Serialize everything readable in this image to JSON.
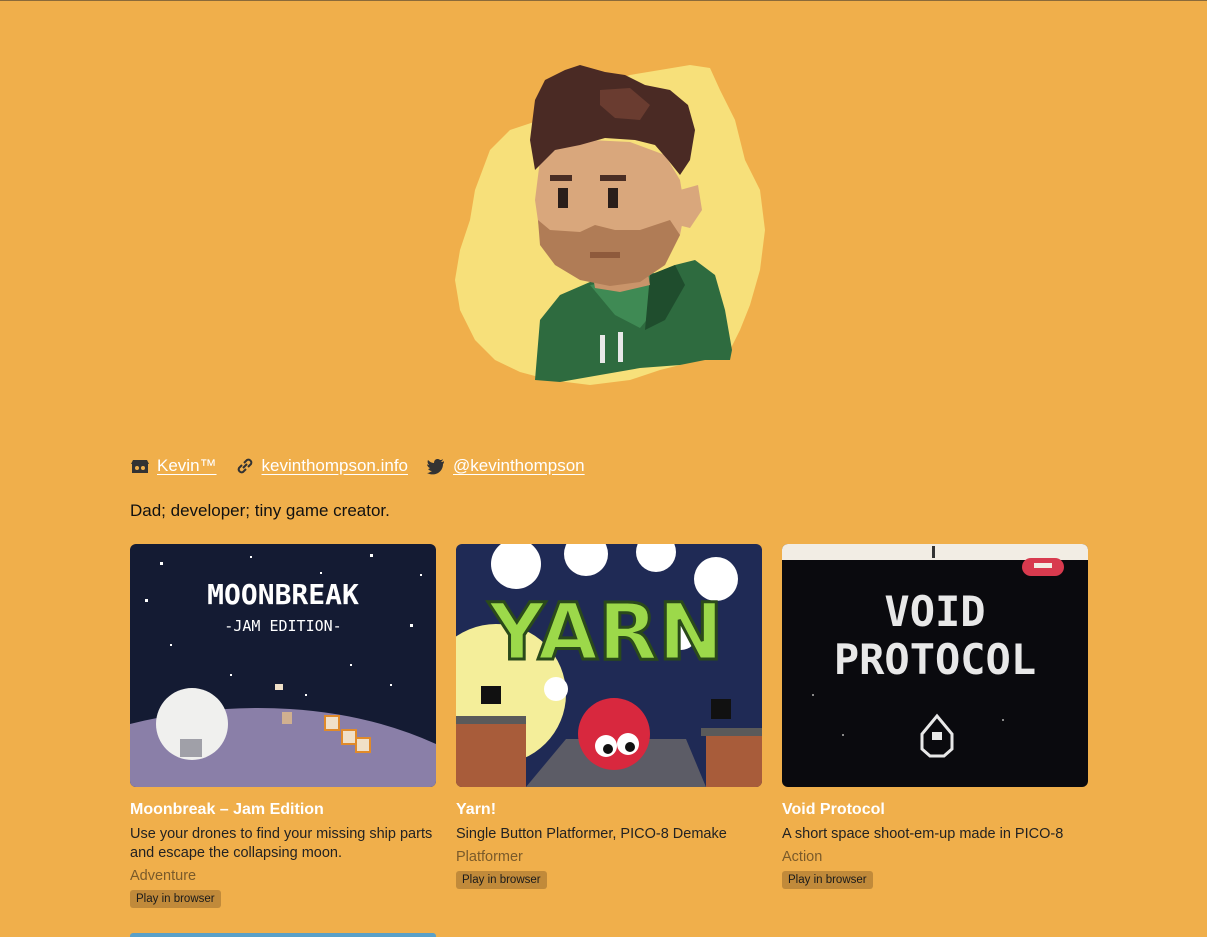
{
  "profile": {
    "name_link": "Kevin™",
    "website_link": "kevinthompson.info",
    "twitter_link": "@kevinthompson",
    "bio": "Dad; developer; tiny game creator."
  },
  "icons": {
    "itch": "itchio-icon",
    "website": "link-icon",
    "twitter": "twitter-icon"
  },
  "colors": {
    "background": "#F0AF4B",
    "badge": "#C18A3A",
    "title": "#FFFFFF"
  },
  "games": [
    {
      "title": "Moonbreak – Jam Edition",
      "thumb_title": "MOONBREAK",
      "thumb_subtitle": "-JAM EDITION-",
      "description": "Use your drones to find your missing ship parts and escape the collapsing moon.",
      "genre": "Adventure",
      "badge": "Play in browser"
    },
    {
      "title": "Yarn!",
      "thumb_title": "YARN",
      "description": "Single Button Platformer, PICO-8 Demake",
      "genre": "Platformer",
      "badge": "Play in browser"
    },
    {
      "title": "Void Protocol",
      "thumb_title_line1": "VOID",
      "thumb_title_line2": "PROTOCOL",
      "description": "A short space shoot-em-up made in PICO-8",
      "genre": "Action",
      "badge": "Play in browser"
    }
  ]
}
